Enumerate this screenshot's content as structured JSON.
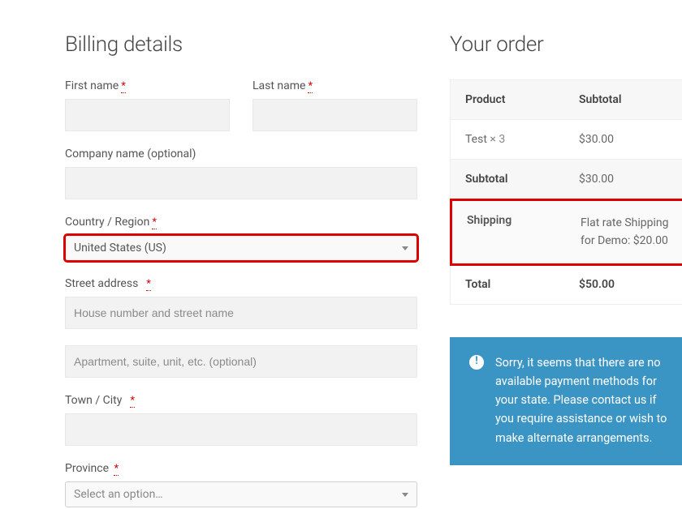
{
  "billing": {
    "heading": "Billing details",
    "first_name_label": "First name",
    "last_name_label": "Last name",
    "company_label": "Company name (optional)",
    "country_label": "Country / Region",
    "country_value": "United States (US)",
    "street_label": "Street address",
    "street_placeholder": "House number and street name",
    "street2_placeholder": "Apartment, suite, unit, etc. (optional)",
    "city_label": "Town / City",
    "province_label": "Province",
    "province_placeholder": "Select an option…"
  },
  "order": {
    "heading": "Your order",
    "head_product": "Product",
    "head_subtotal": "Subtotal",
    "item_name": "Test",
    "item_qty": "× 3",
    "item_subtotal": "$30.00",
    "subtotal_label": "Subtotal",
    "subtotal_value": "$30.00",
    "shipping_label": "Shipping",
    "shipping_value": "Flat rate Shipping for Demo: $20.00",
    "total_label": "Total",
    "total_value": "$50.00"
  },
  "notice": {
    "text": "Sorry, it seems that there are no available payment methods for your state. Please contact us if you require assistance or wish to make alternate arrangements."
  }
}
